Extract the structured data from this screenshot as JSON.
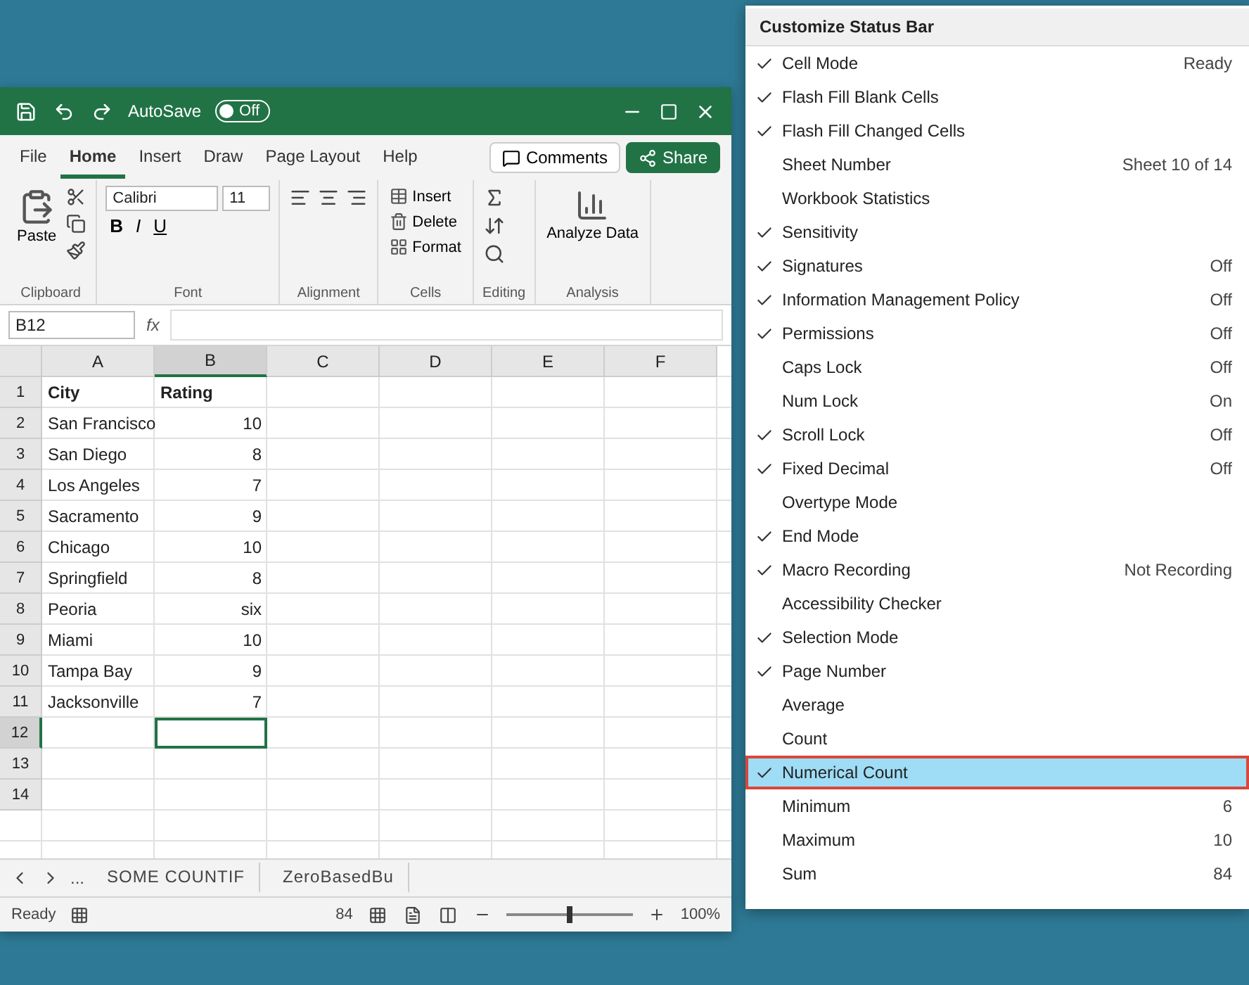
{
  "excel": {
    "autosave": {
      "label": "AutoSave",
      "on": false,
      "state_text": "Off"
    },
    "tabs": [
      {
        "label": "File",
        "selected": false
      },
      {
        "label": "Home",
        "selected": true
      },
      {
        "label": "Insert",
        "selected": false
      },
      {
        "label": "Draw",
        "selected": false
      },
      {
        "label": "Page Layout",
        "selected": false
      },
      {
        "label": "Help",
        "selected": false
      }
    ],
    "comments": "Comments",
    "share": "Share",
    "ribbon_groups": [
      {
        "kind": "clipboard",
        "label": "Clipboard",
        "button": "Paste"
      },
      {
        "kind": "font",
        "label": "Font",
        "font_name": "Calibri",
        "font_size": "11",
        "styles": [
          "B",
          "I",
          "U"
        ]
      },
      {
        "kind": "alignment",
        "label": "Alignment"
      },
      {
        "kind": "cells",
        "label": "Cells",
        "buttons": [
          "Insert",
          "Delete",
          "Format"
        ]
      },
      {
        "kind": "editing",
        "label": "Editing"
      },
      {
        "kind": "analysis",
        "label": "Analysis",
        "button": "Analyze Data"
      }
    ],
    "name_box": "B12",
    "fx": "fx",
    "columns": [
      {
        "label": "A",
        "selected": false
      },
      {
        "label": "B",
        "selected": true
      },
      {
        "label": "C",
        "selected": false
      },
      {
        "label": "D",
        "selected": false
      },
      {
        "label": "E",
        "selected": false
      },
      {
        "label": "F",
        "selected": false
      }
    ],
    "rows": [
      {
        "number": "1",
        "cells": [
          "City",
          "Rating"
        ],
        "selected": false
      },
      {
        "number": "2",
        "cells": [
          "San Francisco",
          "10"
        ],
        "selected": false
      },
      {
        "number": "3",
        "cells": [
          "San Diego",
          "8"
        ],
        "selected": false
      },
      {
        "number": "4",
        "cells": [
          "Los Angeles",
          "7"
        ],
        "selected": false
      },
      {
        "number": "5",
        "cells": [
          "Sacramento",
          "9"
        ],
        "selected": false
      },
      {
        "number": "6",
        "cells": [
          "Chicago",
          "10"
        ],
        "selected": false
      },
      {
        "number": "7",
        "cells": [
          "Springfield",
          "8"
        ],
        "selected": false
      },
      {
        "number": "8",
        "cells": [
          "Peoria",
          "six"
        ],
        "selected": false
      },
      {
        "number": "9",
        "cells": [
          "Miami",
          "10"
        ],
        "selected": false
      },
      {
        "number": "10",
        "cells": [
          "Tampa Bay",
          "9"
        ],
        "selected": false
      },
      {
        "number": "11",
        "cells": [
          "Jacksonville",
          "7"
        ],
        "selected": false
      },
      {
        "number": "12",
        "cells": [],
        "selected": true
      },
      {
        "number": "13",
        "cells": [],
        "selected": false
      },
      {
        "number": "14",
        "cells": [],
        "selected": false
      }
    ],
    "sheet_tabs": [
      {
        "label": "SOME COUNTIF",
        "selected": false
      },
      {
        "label": "ZeroBasedBu",
        "selected": false
      }
    ],
    "more_sheets": "...",
    "status": {
      "mode": "Ready",
      "sum": "84",
      "zoom": "100%",
      "zoom_slider": {
        "level": 0.5
      }
    }
  },
  "menu": {
    "title": "Customize Status Bar",
    "items": [
      {
        "label": "Cell Mode",
        "checked": true,
        "value": "Ready",
        "selected": false
      },
      {
        "label": "Flash Fill Blank Cells",
        "checked": true,
        "selected": false
      },
      {
        "label": "Flash Fill Changed Cells",
        "checked": true,
        "selected": false
      },
      {
        "label": "Sheet Number",
        "checked": false,
        "value": "Sheet 10 of 14",
        "selected": false
      },
      {
        "label": "Workbook Statistics",
        "checked": false,
        "selected": false
      },
      {
        "label": "Sensitivity",
        "checked": true,
        "selected": false
      },
      {
        "label": "Signatures",
        "checked": true,
        "value": "Off",
        "selected": false
      },
      {
        "label": "Information Management Policy",
        "checked": true,
        "value": "Off",
        "selected": false
      },
      {
        "label": "Permissions",
        "checked": true,
        "value": "Off",
        "selected": false
      },
      {
        "label": "Caps Lock",
        "checked": false,
        "value": "Off",
        "selected": false
      },
      {
        "label": "Num Lock",
        "checked": false,
        "value": "On",
        "selected": false
      },
      {
        "label": "Scroll Lock",
        "checked": true,
        "value": "Off",
        "selected": false
      },
      {
        "label": "Fixed Decimal",
        "checked": true,
        "value": "Off",
        "selected": false
      },
      {
        "label": "Overtype Mode",
        "checked": false,
        "selected": false
      },
      {
        "label": "End Mode",
        "checked": true,
        "selected": false
      },
      {
        "label": "Macro Recording",
        "checked": true,
        "value": "Not Recording",
        "selected": false
      },
      {
        "label": "Accessibility Checker",
        "checked": false,
        "selected": false
      },
      {
        "label": "Selection Mode",
        "checked": true,
        "selected": false
      },
      {
        "label": "Page Number",
        "checked": true,
        "selected": false
      },
      {
        "label": "Average",
        "checked": false,
        "selected": false
      },
      {
        "label": "Count",
        "checked": false,
        "selected": false
      },
      {
        "label": "Numerical Count",
        "checked": true,
        "selected": true
      },
      {
        "label": "Minimum",
        "checked": false,
        "value": "6",
        "selected": false
      },
      {
        "label": "Maximum",
        "checked": false,
        "value": "10",
        "selected": false
      },
      {
        "label": "Sum",
        "checked": false,
        "value": "84",
        "selected": false
      }
    ]
  }
}
